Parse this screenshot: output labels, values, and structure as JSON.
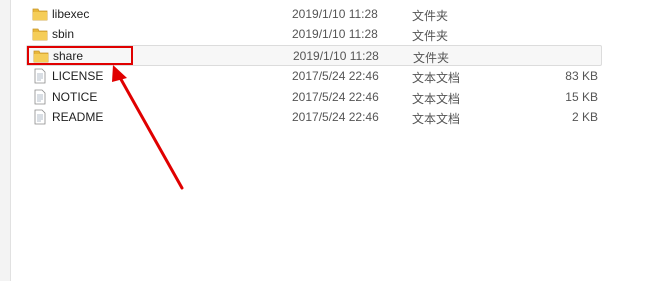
{
  "files": [
    {
      "name": "libexec",
      "date": "2019/1/10 11:28",
      "type": "文件夹",
      "size": "",
      "icon": "folder-icon"
    },
    {
      "name": "sbin",
      "date": "2019/1/10 11:28",
      "type": "文件夹",
      "size": "",
      "icon": "folder-icon"
    },
    {
      "name": "share",
      "date": "2019/1/10 11:28",
      "type": "文件夹",
      "size": "",
      "icon": "folder-icon",
      "selected": true
    },
    {
      "name": "LICENSE",
      "date": "2017/5/24 22:46",
      "type": "文本文档",
      "size": "83 KB",
      "icon": "text-document-icon"
    },
    {
      "name": "NOTICE",
      "date": "2017/5/24 22:46",
      "type": "文本文档",
      "size": "15 KB",
      "icon": "text-document-icon"
    },
    {
      "name": "README",
      "date": "2017/5/24 22:46",
      "type": "文本文档",
      "size": "2 KB",
      "icon": "text-document-icon"
    }
  ],
  "colors": {
    "annotation": "#e00000",
    "folder": "#e8b73a",
    "selected_bg": "#f7f7f7"
  }
}
